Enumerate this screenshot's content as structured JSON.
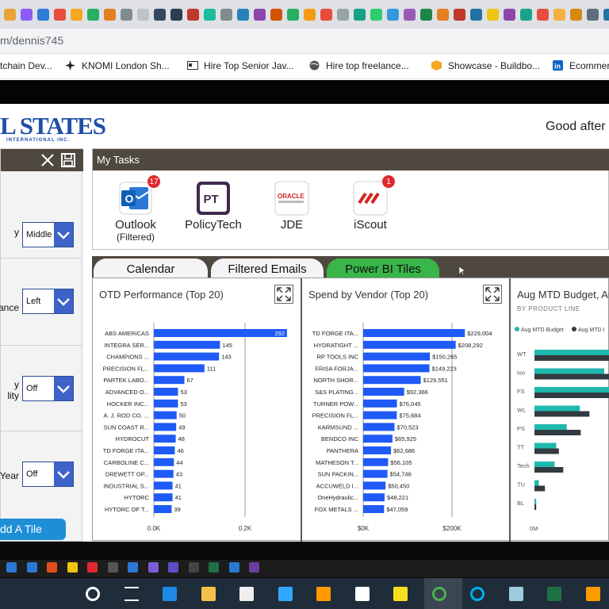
{
  "browser": {
    "tab_icon_colors": [
      "#e8a43a",
      "#8b5cf6",
      "#2e7dd7",
      "#e74c3c",
      "#f5a623",
      "#27ae60",
      "#e67e22",
      "#7f8c8d",
      "#bdc3c7",
      "#34495e",
      "#2c3e50",
      "#c0392b",
      "#1abc9c",
      "#7f8c8d",
      "#2980b9",
      "#8e44ad",
      "#d35400",
      "#27ae60",
      "#f39c12",
      "#e74c3c",
      "#95a5a6",
      "#16a085",
      "#2ecc71",
      "#3498db",
      "#9b59b6",
      "#1e8449",
      "#e67e22",
      "#c0392b",
      "#2471a3",
      "#f1c40f",
      "#8e44ad",
      "#17a589",
      "#e74c3c",
      "#f5b041",
      "#d68910",
      "#5d6d7e",
      "#2874a6",
      "#1f618d",
      "#7d3c98",
      "#cb4335",
      "#a569bd",
      "#f39c12",
      "#e67e22",
      "#ec7063",
      "#5499c7"
    ],
    "url": "m/dennis745",
    "bookmarks": [
      {
        "label": "tchain Dev...",
        "icon": "page-icon"
      },
      {
        "label": "KNOMI London Sh...",
        "icon": "sparkle-icon"
      },
      {
        "label": "Hire Top Senior Jav...",
        "icon": "card-icon"
      },
      {
        "label": "Hire top freelance...",
        "icon": "globe-icon"
      },
      {
        "label": "Showcase - Buildbo...",
        "icon": "box-icon"
      },
      {
        "label": "Ecommer",
        "icon": "linkedin-icon"
      }
    ]
  },
  "header": {
    "logo_text": "L STATES",
    "logo_subtext": "INTERNATIONAL INC.",
    "greeting": "Good after"
  },
  "settings_panel": {
    "items": [
      {
        "label": "y",
        "value": "Middle"
      },
      {
        "label": "ance",
        "value": "Left"
      },
      {
        "label": "y\nlity",
        "value": "Off"
      },
      {
        "label": "Year",
        "value": "Off"
      }
    ],
    "add_tile_label": "dd A Tile"
  },
  "my_tasks": {
    "title": "My Tasks",
    "tasks": [
      {
        "label": "Outlook",
        "sublabel": "(Filtered)",
        "badge": "17",
        "icon_text": "O"
      },
      {
        "label": "PolicyTech",
        "sublabel": "",
        "badge": "",
        "icon_text": "PT"
      },
      {
        "label": "JDE",
        "sublabel": "",
        "badge": "",
        "icon_text": "ORACLE"
      },
      {
        "label": "iScout",
        "sublabel": "",
        "badge": "1",
        "icon_text": "///"
      }
    ]
  },
  "tabs": [
    {
      "label": "Calendar",
      "active": false
    },
    {
      "label": "Filtered Emails",
      "active": false
    },
    {
      "label": "Power BI Tiles",
      "active": true
    }
  ],
  "tiles": [
    {
      "title": "OTD Performance (Top 20)"
    },
    {
      "title": "Spend by Vendor (Top 20)"
    },
    {
      "title": "Aug MTD Budget, Au",
      "subtitle": "BY PRODUCT LINE"
    }
  ],
  "chart_data": [
    {
      "type": "bar",
      "orientation": "horizontal",
      "title": "OTD Performance (Top 20)",
      "categories": [
        "ABS AMERICAS",
        "INTEGRA SER...",
        "CHAMPIONS ...",
        "PRECISION FL...",
        "PARTEK LABO...",
        "ADVANCED O...",
        "HOCKER INC...",
        "A. J. ROD CO. ...",
        "SUN COAST R...",
        "HYDROCUT",
        "TD FORGE ITA...",
        "CARBOLINE C...",
        "DREWETT OP...",
        "INDUSTRIAL S...",
        "HYTORC",
        "HYTORC OF T..."
      ],
      "values": [
        292,
        145,
        143,
        111,
        67,
        53,
        53,
        50,
        49,
        48,
        46,
        44,
        43,
        41,
        41,
        39
      ],
      "labels": [
        "292",
        "145",
        "143",
        "111",
        "67",
        "53",
        "53",
        "50",
        "49",
        "48",
        "46",
        "44",
        "43",
        "41",
        "41",
        "39"
      ],
      "xticks": [
        "0.0K",
        "0.2K"
      ],
      "xlim": [
        0,
        200
      ],
      "color": "#1f5af6"
    },
    {
      "type": "bar",
      "orientation": "horizontal",
      "title": "Spend by Vendor (Top 20)",
      "categories": [
        "TD FORGE ITA...",
        "HYDRATIGHT ...",
        "RP TOOLS INC",
        "FRISA FORJA...",
        "NORTH SHOR...",
        "S&S PLATING...",
        "TURNER POW...",
        "PRECISION FL...",
        "KARMSUND ...",
        "BENDCO INC",
        "PANTHERA",
        "MATHESON T...",
        "SUN PACKIN...",
        "ACCUWELD I...",
        "OneHydraulic...",
        "FOX METALS ..."
      ],
      "values": [
        229004,
        208292,
        150265,
        149223,
        129551,
        92366,
        76045,
        75684,
        70523,
        65925,
        62686,
        56105,
        54746,
        50450,
        48221,
        47059
      ],
      "labels": [
        "$229,004",
        "$208,292",
        "$150,265",
        "$149,223",
        "$129,551",
        "$92,366",
        "$76,045",
        "$75,684",
        "$70,523",
        "$65,925",
        "$62,686",
        "$56,105",
        "$54,746",
        "$50,450",
        "$48,221",
        "$47,059"
      ],
      "xticks": [
        "$0K",
        "$200K"
      ],
      "xlim": [
        0,
        200000
      ],
      "color": "#1f5af6"
    },
    {
      "type": "bar",
      "orientation": "horizontal",
      "title": "Aug MTD Budget, Au",
      "subtitle": "BY PRODUCT LINE",
      "categories": [
        "WT",
        "Iso",
        "FS",
        "WL",
        "PS",
        "TT",
        "Tech",
        "TU",
        "BL"
      ],
      "series": [
        {
          "name": "Aug MTD Budget",
          "color": "#1fb8ad",
          "values": [
            1.0,
            0.8,
            0.9,
            0.52,
            0.37,
            0.25,
            0.23,
            0.05,
            0.02
          ]
        },
        {
          "name": "Aug MTD I",
          "color": "#333a40",
          "values": [
            1.0,
            0.92,
            0.96,
            0.63,
            0.53,
            0.28,
            0.33,
            0.12,
            0.02
          ]
        }
      ],
      "xticks": [
        "0M"
      ],
      "xlim": [
        0,
        1
      ]
    }
  ]
}
